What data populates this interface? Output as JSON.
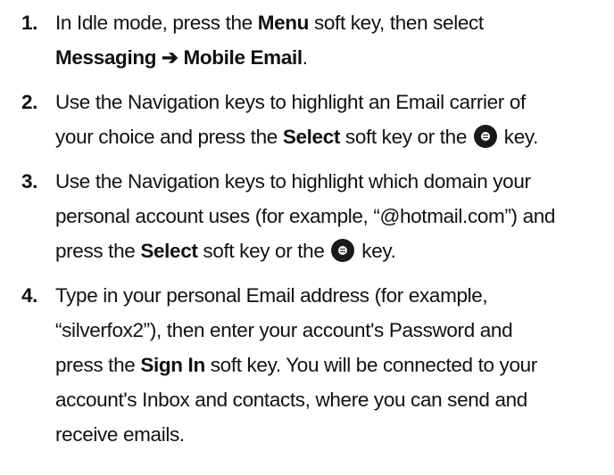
{
  "steps": [
    {
      "number": "1.",
      "parts": {
        "a": "In Idle mode, press the ",
        "b": "Menu",
        "c": " soft key, then select",
        "d": "Messaging",
        "e": "➔",
        "f": "Mobile Email",
        "g": "."
      }
    },
    {
      "number": "2.",
      "parts": {
        "a": "Use the Navigation keys to highlight an Email carrier of",
        "b": "your choice and press the ",
        "c": "Select",
        "d": " soft key or the ",
        "e": " key."
      }
    },
    {
      "number": "3.",
      "parts": {
        "a": "Use the Navigation keys to highlight which domain your",
        "b": "personal account uses (for example, “@hotmail.com”) and",
        "c": "press the ",
        "d": "Select",
        "e": " soft key or the ",
        "f": " key."
      }
    },
    {
      "number": "4.",
      "parts": {
        "a": "Type in your personal Email address (for example,",
        "b": "“silverfox2”), then enter your account's Password and",
        "c": "press the ",
        "d": "Sign In",
        "e": " soft key. You will be connected to your",
        "f": "account's Inbox and contacts, where you can send and",
        "g": "receive emails."
      }
    }
  ],
  "icons": {
    "ok_key": "ok-key-icon"
  }
}
